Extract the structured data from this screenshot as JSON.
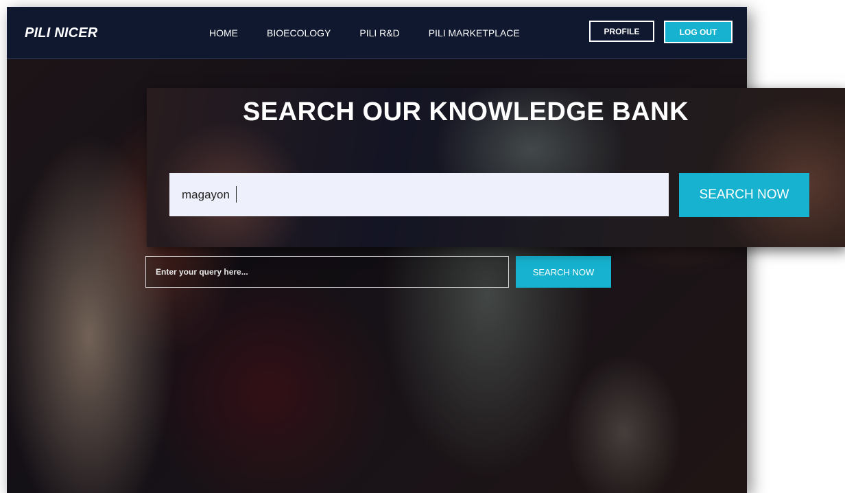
{
  "brand": "PILI NICER",
  "nav": {
    "items": [
      "HOME",
      "BIOECOLOGY",
      "PILI R&D",
      "PILI MARKETPLACE"
    ]
  },
  "header": {
    "profile_label": "PROFILE",
    "logout_label": "LOG OUT"
  },
  "search": {
    "placeholder": "Enter your query here...",
    "button_label": "SEARCH NOW"
  },
  "zoom": {
    "title": "SEARCH OUR KNOWLEDGE BANK",
    "input_value": "magayon",
    "button_label": "SEARCH NOW"
  },
  "colors": {
    "accent": "#17b2cf",
    "navbar": "#101830"
  }
}
